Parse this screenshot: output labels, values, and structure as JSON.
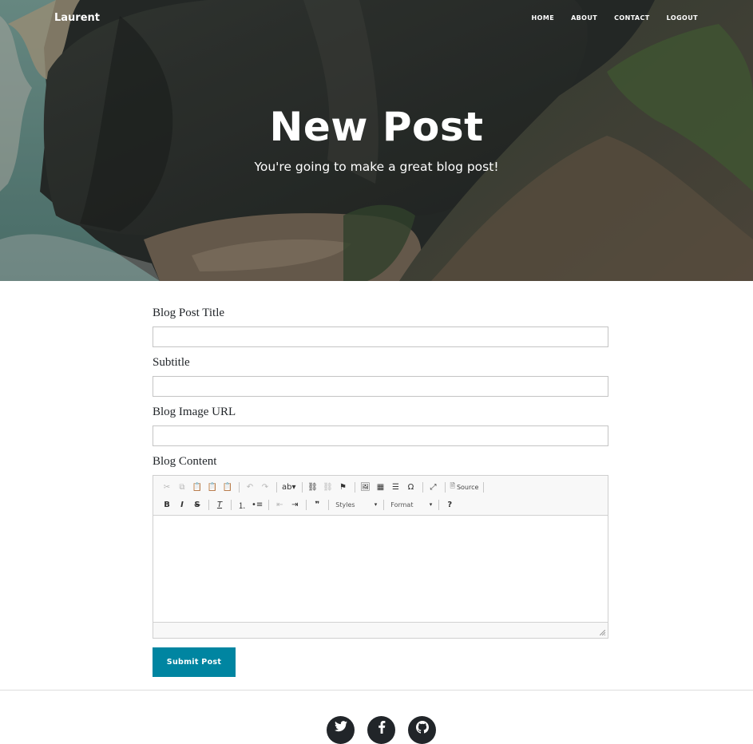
{
  "nav": {
    "brand": "Laurent",
    "links": [
      "HOME",
      "ABOUT",
      "CONTACT",
      "LOGOUT"
    ]
  },
  "hero": {
    "title": "New Post",
    "subtitle": "You're going to make a great blog post!"
  },
  "form": {
    "title_label": "Blog Post Title",
    "title_value": "",
    "subtitle_label": "Subtitle",
    "subtitle_value": "",
    "image_label": "Blog Image URL",
    "image_value": "",
    "content_label": "Blog Content",
    "submit_label": "Submit Post"
  },
  "editor": {
    "source_label": "Source",
    "styles_label": "Styles",
    "format_label": "Format",
    "toolbar_row1": [
      "cut-icon",
      "copy-icon",
      "paste-icon",
      "paste-text-icon",
      "paste-word-icon",
      "undo-icon",
      "redo-icon",
      "spellcheck-icon",
      "link-icon",
      "unlink-icon",
      "anchor-icon",
      "image-icon",
      "table-icon",
      "horizontal-rule-icon",
      "special-char-icon",
      "maximize-icon",
      "source-icon"
    ],
    "toolbar_row2": [
      "bold-icon",
      "italic-icon",
      "strike-icon",
      "remove-format-icon",
      "numbered-list-icon",
      "bulleted-list-icon",
      "outdent-icon",
      "indent-icon",
      "blockquote-icon",
      "styles-dropdown",
      "format-dropdown",
      "help-icon"
    ]
  },
  "footer": {
    "social": [
      "twitter-icon",
      "facebook-icon",
      "github-icon"
    ]
  },
  "colors": {
    "accent": "#0085a1",
    "text": "#212529"
  }
}
